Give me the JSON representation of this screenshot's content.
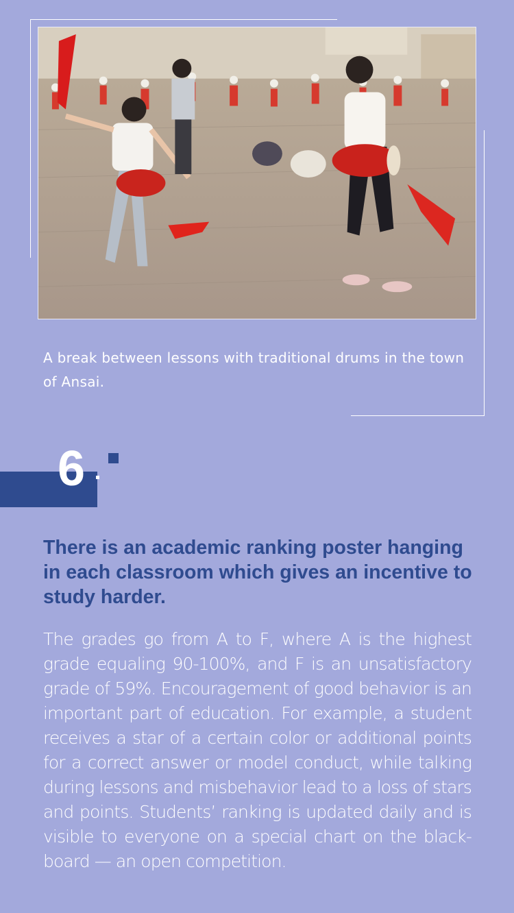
{
  "photo": {
    "description_icon": "photo-image"
  },
  "caption": {
    "text": "A break between lessons with traditional drums in the town of Ansai."
  },
  "section": {
    "number": "6",
    "heading": "There is an academic ranking poster hanging in each classroom which gives an incentive to study harder.",
    "body": "The grades go from A to F, where A is the highest grade equaling 90-100%, and F is an unsatisfactory grade of 59%. Encouragement of good behavior is an important part of education. For example, a student receives a star of a certain color or additional points for a correct answer or model conduct, while talking during lessons and misbehavior lead to a loss of stars and points. Students’ ranking is updated daily and is visible to everyone on a special chart on the black-board — an open competition."
  },
  "colors": {
    "background": "#a3a9dc",
    "accent": "#2f4b8f",
    "text": "#ffffff"
  }
}
